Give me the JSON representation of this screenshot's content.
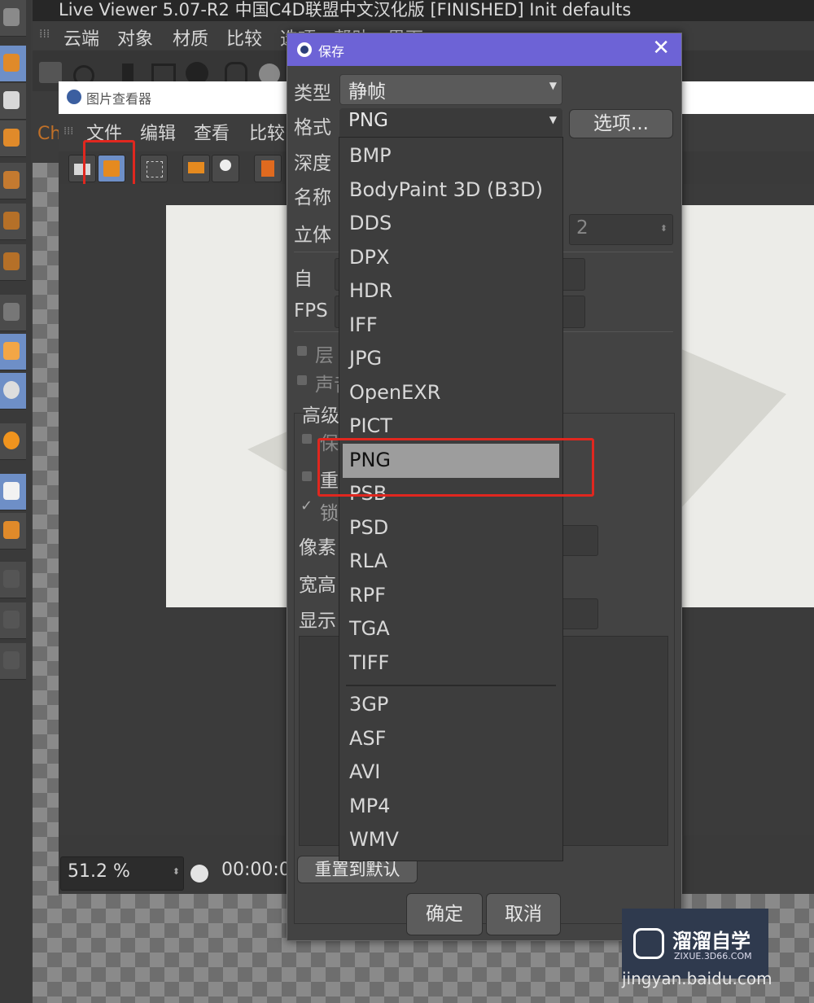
{
  "app": {
    "title": "Live Viewer 5.07-R2 中国C4D联盟中文汉化版   [FINISHED] Init defaults",
    "menu": [
      "云端",
      "对象",
      "材质",
      "比较",
      "选项",
      "帮助",
      "界面"
    ]
  },
  "picture_viewer": {
    "title": "图片查看器",
    "left_label": "Ch",
    "menu": [
      "文件",
      "编辑",
      "查看",
      "比较"
    ],
    "zoom": "51.2 %",
    "time": "00:00:0"
  },
  "dialog": {
    "title": "保存",
    "labels": {
      "type": "类型",
      "format": "格式",
      "depth": "深度",
      "name": "名称",
      "stereo": "立体",
      "from": "自",
      "fps": "FPS",
      "layers": "层",
      "sound": "声音",
      "advanced": "高级",
      "keep": "保",
      "redo": "重",
      "lock": "锁",
      "pixel": "像素",
      "aspect": "宽高",
      "display": "显示"
    },
    "type_value": "静帧",
    "format_value": "PNG",
    "stereo_value": "2",
    "options_button": "选项...",
    "reset_button": "重置到默认",
    "ok_button": "确定",
    "cancel_button": "取消",
    "format_options": [
      "BMP",
      "BodyPaint 3D (B3D)",
      "DDS",
      "DPX",
      "HDR",
      "IFF",
      "JPG",
      "OpenEXR",
      "PICT",
      "PNG",
      "PSB",
      "PSD",
      "RLA",
      "RPF",
      "TGA",
      "TIFF"
    ],
    "video_options": [
      "3GP",
      "ASF",
      "AVI",
      "MP4",
      "WMV"
    ],
    "selected_option": "PNG"
  },
  "watermark": {
    "brand": "溜溜自学",
    "site": "ZIXUE.3D66.COM",
    "credit": "jingyan.baidu.com"
  },
  "colors": {
    "dialog_title_bar": "#6d63d6",
    "highlight_box": "#e0271f",
    "selected_item": "#9d9d9d"
  }
}
